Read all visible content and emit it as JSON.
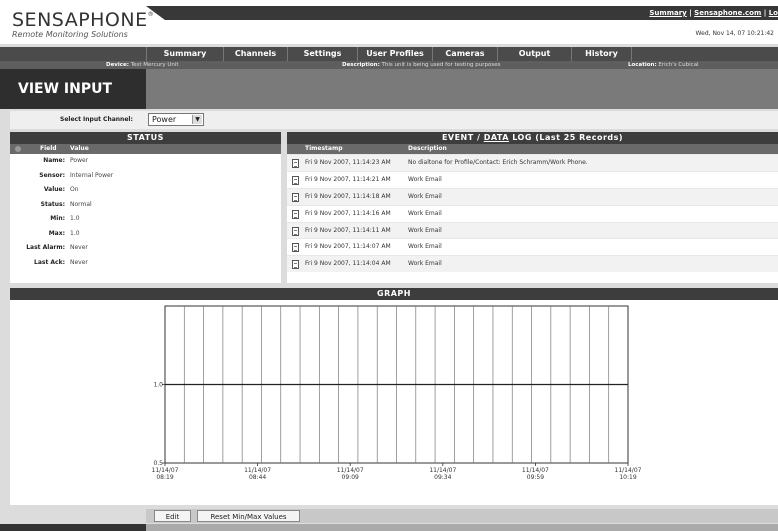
{
  "brand": {
    "name": "SENSAPHONE",
    "reg": "®",
    "tagline": "Remote Monitoring Solutions"
  },
  "top_links": {
    "summary": "Summary",
    "sep1": " | ",
    "sensaphone": "Sensaphone.com",
    "sep2": " | ",
    "logout": "Lo"
  },
  "datetime": "Wed, Nov 14, 07 10:21:42",
  "nav": [
    "Summary",
    "Channels",
    "Settings",
    "User Profiles",
    "Cameras",
    "Output",
    "History"
  ],
  "info": {
    "device_label": "Device:",
    "device": "Test Mercury Unit",
    "description_label": "Description:",
    "description": "This unit is being used for testing purposes",
    "location_label": "Location:",
    "location": "Erich's Cubical"
  },
  "page_title": "VIEW INPUT",
  "select": {
    "label": "Select Input Channel:",
    "value": "Power"
  },
  "status": {
    "title": "STATUS",
    "col_field": "Field",
    "col_value": "Value",
    "rows": [
      {
        "field": "Name:",
        "value": "Power"
      },
      {
        "field": "Sensor:",
        "value": "Internal Power"
      },
      {
        "field": "Value:",
        "value": "On"
      },
      {
        "field": "Status:",
        "value": "Normal"
      },
      {
        "field": "Min:",
        "value": "1.0"
      },
      {
        "field": "Max:",
        "value": "1.0"
      },
      {
        "field": "Last Alarm:",
        "value": "Never"
      },
      {
        "field": "Last Ack:",
        "value": "Never"
      }
    ]
  },
  "log": {
    "title_pre": "EVENT / ",
    "title_link": "DATA",
    "title_post": " LOG (Last 25 Records)",
    "col_timestamp": "Timestamp",
    "col_description": "Description",
    "rows": [
      {
        "ts": "Fri 9 Nov 2007, 11:14:23 AM",
        "desc": "No dialtone for Profile/Contact: Erich Schramm/Work Phone."
      },
      {
        "ts": "Fri 9 Nov 2007, 11:14:21 AM",
        "desc": "Work Email"
      },
      {
        "ts": "Fri 9 Nov 2007, 11:14:18 AM",
        "desc": "Work Email"
      },
      {
        "ts": "Fri 9 Nov 2007, 11:14:16 AM",
        "desc": "Work Email"
      },
      {
        "ts": "Fri 9 Nov 2007, 11:14:11 AM",
        "desc": "Work Email"
      },
      {
        "ts": "Fri 9 Nov 2007, 11:14:07 AM",
        "desc": "Work Email"
      },
      {
        "ts": "Fri 9 Nov 2007, 11:14:04 AM",
        "desc": "Work Email"
      }
    ]
  },
  "graph": {
    "title": "GRAPH"
  },
  "chart_data": {
    "type": "line",
    "title": "GRAPH",
    "xlabel": "",
    "ylabel": "",
    "x_ticks": [
      {
        "date": "11/14/07",
        "time": "08:19"
      },
      {
        "date": "11/14/07",
        "time": "08:44"
      },
      {
        "date": "11/14/07",
        "time": "09:09"
      },
      {
        "date": "11/14/07",
        "time": "09:34"
      },
      {
        "date": "11/14/07",
        "time": "09:59"
      },
      {
        "date": "11/14/07",
        "time": "10:19"
      }
    ],
    "y_ticks": [
      "1.0",
      "0.5"
    ],
    "ylim": [
      0.5,
      1.5
    ],
    "vertical_gridlines": 24,
    "series": [
      {
        "values": [
          1.0,
          1.0
        ]
      }
    ]
  },
  "buttons": {
    "edit": "Edit",
    "reset": "Reset Min/Max Values"
  }
}
